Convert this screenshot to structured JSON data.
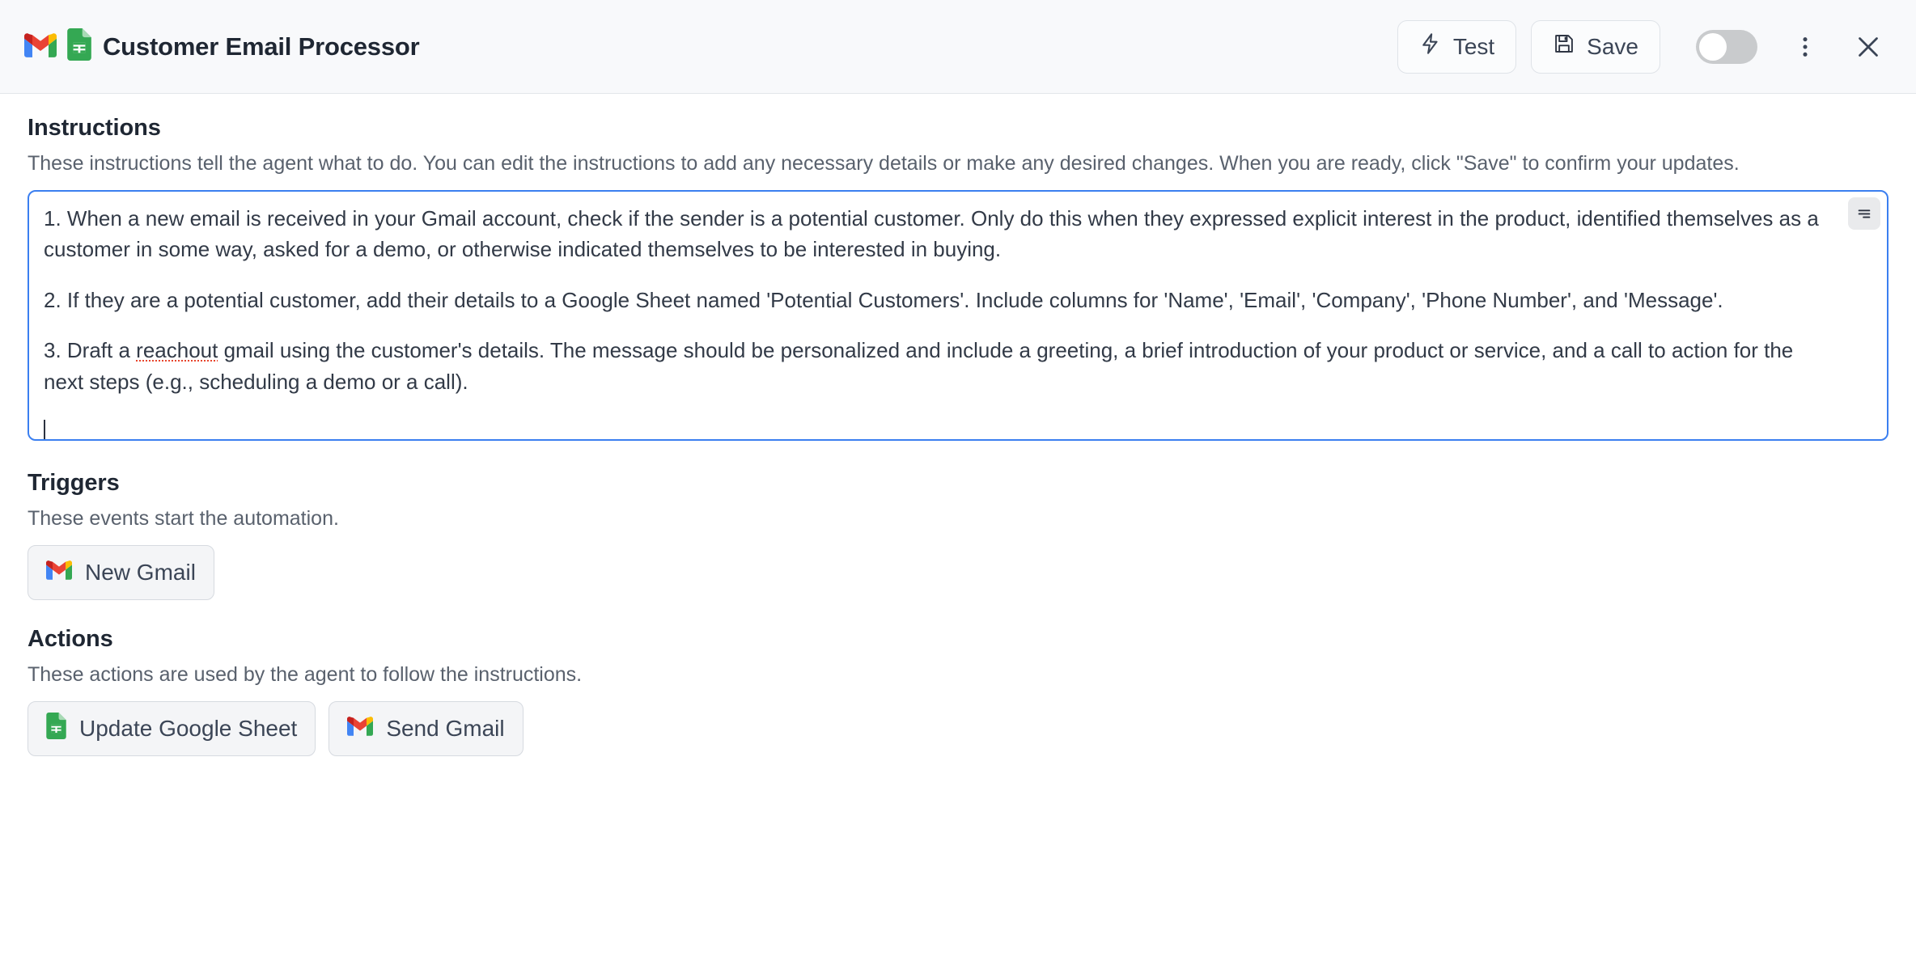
{
  "header": {
    "icons": [
      "gmail-icon",
      "google-sheets-icon"
    ],
    "title": "Customer Email Processor",
    "test_label": "Test",
    "save_label": "Save",
    "toggle_state": "off",
    "menu_icon": "kebab-menu-icon",
    "close_icon": "close-icon",
    "accent_color": "#3b7ff0"
  },
  "instructions": {
    "title": "Instructions",
    "description": "These instructions tell the agent what to do. You can edit the instructions to add any necessary details or make any desired changes. When you are ready, click \"Save\" to confirm your updates.",
    "paragraph_1_a": "1. When a new email is received in your Gmail account, check if the sender is a potential customer. Only do this when they expressed explicit interest in the product, identified themselves as a customer in some way, asked for a demo, or otherwise indicated themselves to be interested in buying.",
    "paragraph_2": "2. If they are a potential customer, add their details to a Google Sheet named 'Potential Customers'. Include columns for 'Name', 'Email', 'Company', 'Phone Number', and 'Message'.",
    "paragraph_3_before": "3. Draft a ",
    "paragraph_3_misspelled": "reachout",
    "paragraph_3_after": " gmail using the customer's details. The message should be personalized and include a greeting, a brief introduction of your product or service, and a call to action for the next steps (e.g., scheduling a demo or a call).",
    "handle_icon": "text-lines-handle-icon",
    "spellcheck_color": "#e8452c"
  },
  "triggers": {
    "title": "Triggers",
    "description": "These events start the automation.",
    "items": [
      {
        "label": "New Gmail",
        "icon": "gmail-icon"
      }
    ]
  },
  "actions": {
    "title": "Actions",
    "description": "These actions are used by the agent to follow the instructions.",
    "items": [
      {
        "label": "Update Google Sheet",
        "icon": "google-sheets-icon"
      },
      {
        "label": "Send Gmail",
        "icon": "gmail-icon"
      }
    ]
  }
}
